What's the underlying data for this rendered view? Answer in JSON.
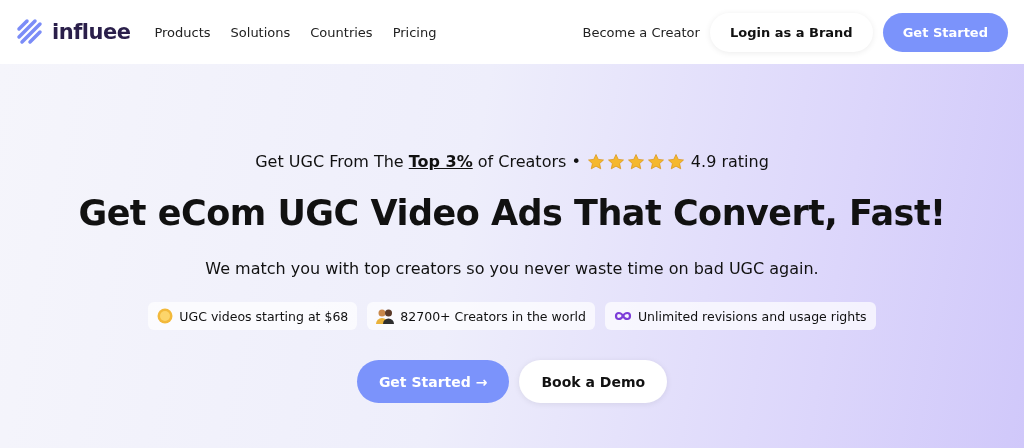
{
  "nav": {
    "logo": "influee",
    "links": [
      "Products",
      "Solutions",
      "Countries",
      "Pricing"
    ],
    "creator_link": "Become a Creator",
    "login_button": "Login as a Brand",
    "cta_button": "Get Started"
  },
  "hero": {
    "tagline": "Get UGC From The **Top 3%** of Creators •",
    "stars": 5,
    "rating": "4.9 rating",
    "headline": "Get eCom UGC Video Ads That Convert, Fast!",
    "subtitle": "We match you with top creators so you never waste time on bad UGC again.",
    "badges": [
      {
        "kind": "coin",
        "text": "UGC videos starting at $68"
      },
      {
        "kind": "people",
        "text": "82700+ Creators in the world"
      },
      {
        "kind": "infinity",
        "text": "Unlimited revisions and usage rights"
      }
    ],
    "buttons": [
      {
        "kind": "primary",
        "label": "Get Started →"
      },
      {
        "kind": "secondary",
        "label": "Book a Demo"
      }
    ]
  }
}
